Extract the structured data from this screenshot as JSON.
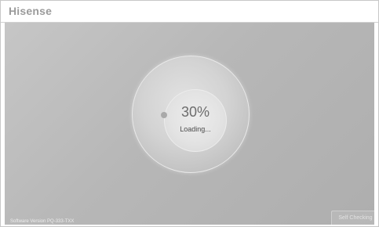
{
  "header": {
    "brand": "Hisense"
  },
  "loader": {
    "progress_text": "30%",
    "progress_value": 0.3,
    "status_text": "Loading..."
  },
  "footer": {
    "software_version": "Software Version PQ-333-TXX",
    "self_check_label": "Self Checking"
  },
  "colors": {
    "background": "#b9b9b9",
    "logo": "#9b9b9b",
    "ring": "#e9e9e9"
  }
}
